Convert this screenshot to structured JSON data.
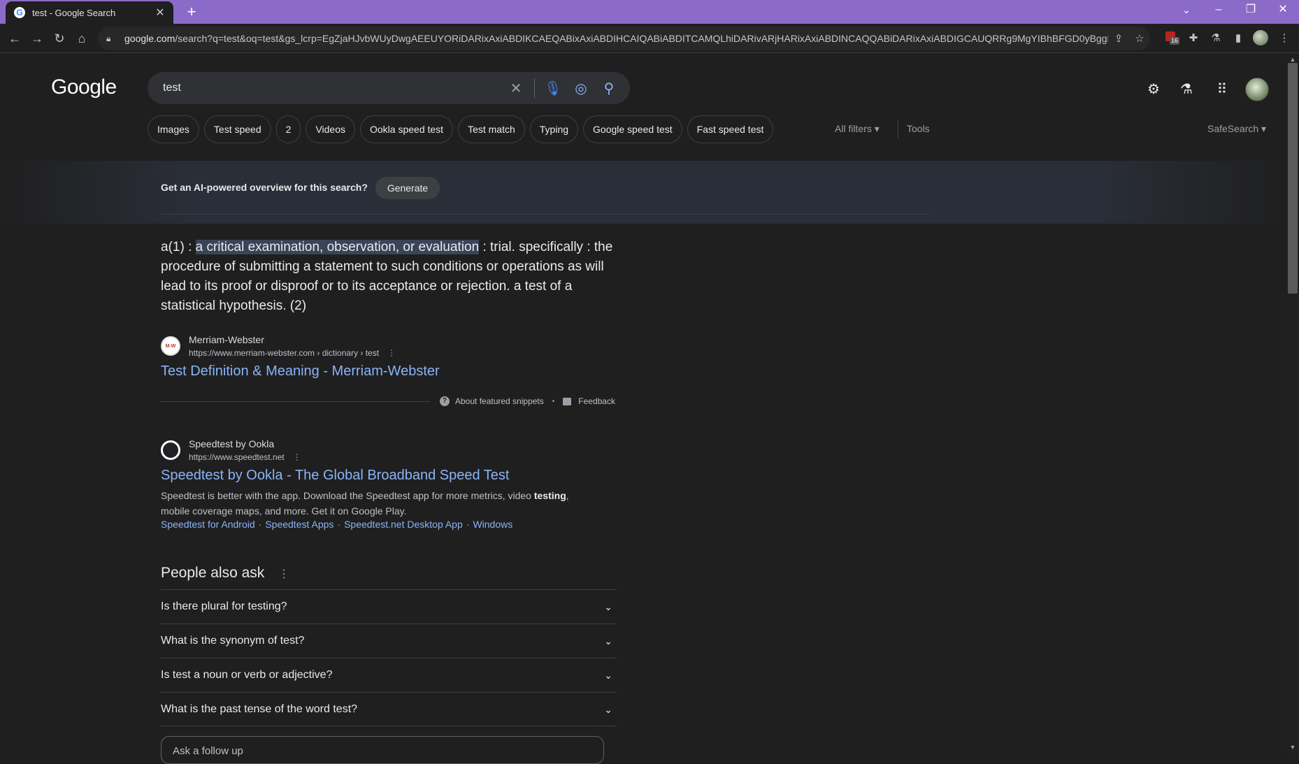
{
  "browser": {
    "tab_title": "test - Google Search",
    "favicon_letter": "G",
    "url_host": "google.com",
    "url_path": "/search?q=test&oq=test&gs_lcrp=EgZjaHJvbWUyDwgAEEUYORiDARixAxiABDIKCAEQABixAxiABDIHCAIQABiABDITCAMQLhiDARivARjHARixAxiABDINCAQQABiDARixAxiABDIGCAUQRRg9MgYIBhBFGD0yBggHEEUYPdI...",
    "ext_badge": "16"
  },
  "google": {
    "logo": "Google",
    "query": "test",
    "chips": [
      "Images",
      "Test speed",
      "2",
      "Videos",
      "Ookla speed test",
      "Test match",
      "Typing",
      "Google speed test",
      "Fast speed test"
    ],
    "all_filters": "All filters ▾",
    "tools": "Tools",
    "safesearch": "SafeSearch ▾"
  },
  "ai": {
    "prompt": "Get an AI-powered overview for this search?",
    "generate": "Generate"
  },
  "snippet": {
    "prefix": "a(1) : ",
    "highlight": "a critical examination, observation, or evaluation",
    "rest": " : trial. specifically : the procedure of submitting a statement to such conditions or operations as will lead to its proof or disproof or to its acceptance or rejection. a test of a statistical hypothesis. (2)",
    "source_name": "Merriam-Webster",
    "source_url": "https://www.merriam-webster.com › dictionary › test",
    "favicon_text": "M-W",
    "title": "Test Definition & Meaning - Merriam-Webster",
    "about": "About featured snippets",
    "feedback": "Feedback",
    "dot": "•"
  },
  "result2": {
    "source_name": "Speedtest by Ookla",
    "source_url": "https://www.speedtest.net",
    "title": "Speedtest by Ookla - The Global Broadband Speed Test",
    "desc_before": "Speedtest is better with the app. Download the Speedtest app for more metrics, video ",
    "desc_bold": "testing",
    "desc_after": ", mobile coverage maps, and more. Get it on Google Play.",
    "sitelinks": [
      "Speedtest for Android",
      "Speedtest Apps",
      "Speedtest.net Desktop App",
      "Windows"
    ],
    "sitelink_sep": "·"
  },
  "paa": {
    "title": "People also ask",
    "questions": [
      "Is there plural for testing?",
      "What is the synonym of test?",
      "Is test a noun or verb or adjective?",
      "What is the past tense of the word test?"
    ],
    "followup_placeholder": "Ask a follow up"
  }
}
